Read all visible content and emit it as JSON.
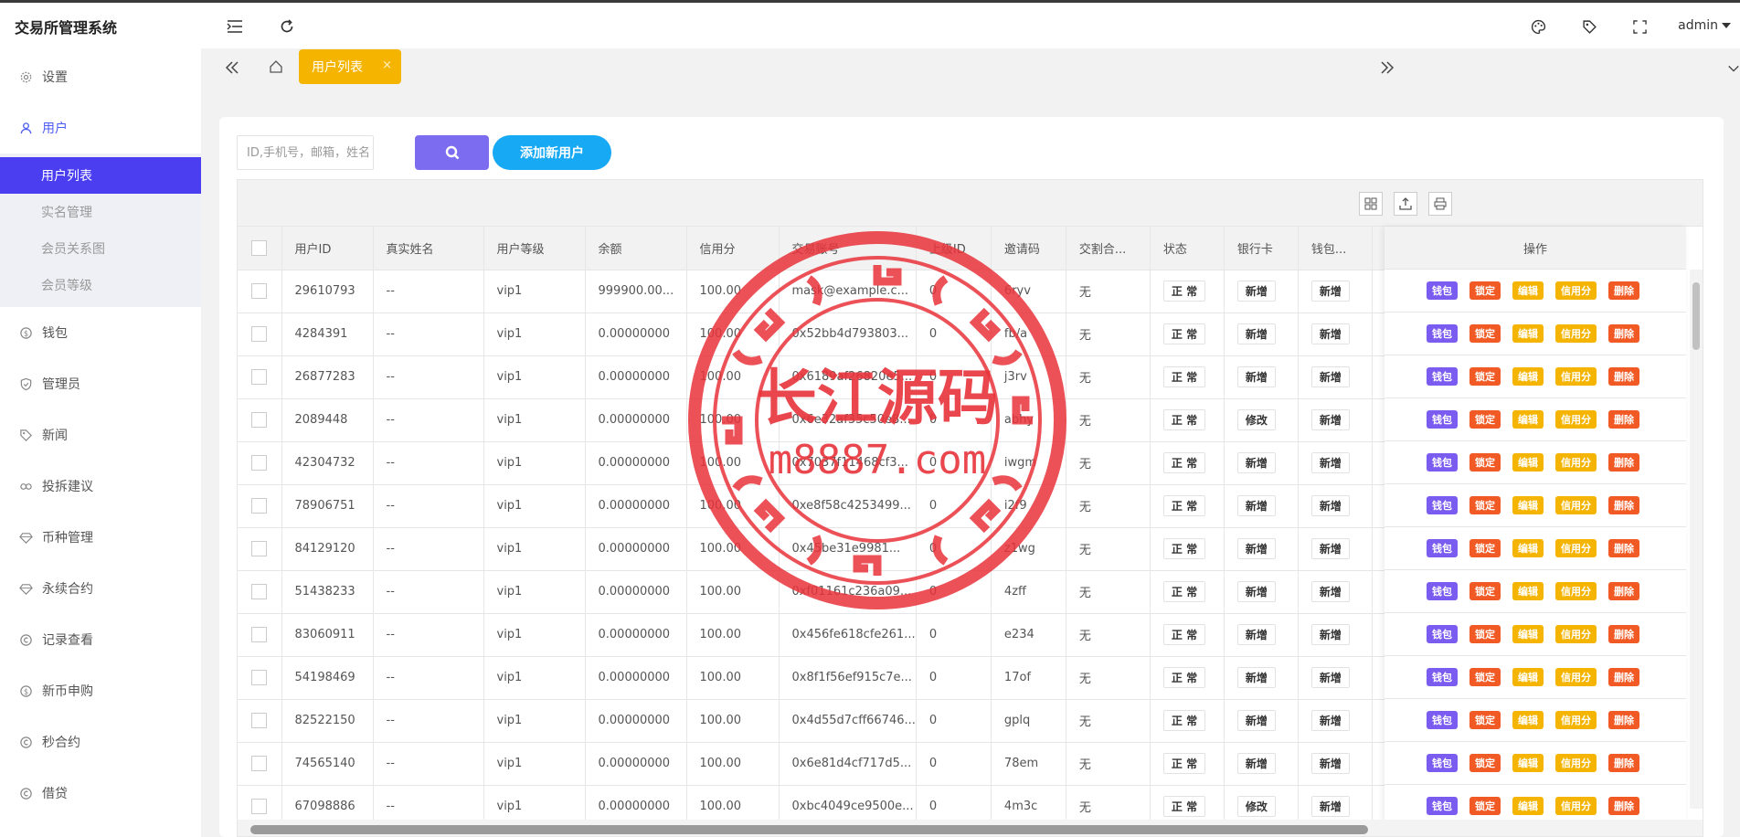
{
  "app": {
    "title": "交易所管理系统"
  },
  "header": {
    "user": "admin"
  },
  "sidebar": {
    "items": [
      {
        "label": "设置",
        "icon": "gear-icon"
      },
      {
        "label": "用户",
        "icon": "user-icon",
        "active": true
      },
      {
        "label": "钱包",
        "icon": "coin-icon"
      },
      {
        "label": "管理员",
        "icon": "shield-icon"
      },
      {
        "label": "新闻",
        "icon": "tag-icon"
      },
      {
        "label": "投拆建议",
        "icon": "link-icon"
      },
      {
        "label": "币种管理",
        "icon": "diamond-icon"
      },
      {
        "label": "永续合约",
        "icon": "diamond-icon"
      },
      {
        "label": "记录查看",
        "icon": "copyright-icon"
      },
      {
        "label": "新币申购",
        "icon": "coin-icon"
      },
      {
        "label": "秒合约",
        "icon": "copyright-icon"
      },
      {
        "label": "借贷",
        "icon": "copyright-icon"
      }
    ],
    "sub_items": [
      {
        "label": "用户列表",
        "active": true
      },
      {
        "label": "实名管理"
      },
      {
        "label": "会员关系图"
      },
      {
        "label": "会员等级"
      }
    ]
  },
  "tabs": {
    "active_label": "用户列表",
    "close": "×"
  },
  "search": {
    "placeholder": "ID,手机号，邮箱，姓名",
    "add_label": "添加新用户"
  },
  "table": {
    "headers": [
      "用户ID",
      "真实姓名",
      "用户等级",
      "余额",
      "信用分",
      "交易账号",
      "上级ID",
      "邀请码",
      "交割合...",
      "状态",
      "银行卡",
      "钱包..."
    ],
    "ops_header": "操作",
    "op_buttons": [
      {
        "label": "钱包",
        "color": "#7b5cf0"
      },
      {
        "label": "锁定",
        "color": "#f15a24"
      },
      {
        "label": "编辑",
        "color": "#f5b400"
      },
      {
        "label": "信用分",
        "color": "#f5b400"
      },
      {
        "label": "删除",
        "color": "#f15a24"
      }
    ],
    "rows": [
      [
        "29610793",
        "--",
        "vip1",
        "999900.00...",
        "100.00",
        "mask@example.c...",
        "0",
        "6ryv",
        "无",
        "正 常",
        "新增",
        "新增"
      ],
      [
        "4284391",
        "--",
        "vip1",
        "0.00000000",
        "100.00",
        "0x52bb4d793803...",
        "0",
        "fb/a",
        "无",
        "正 常",
        "新增",
        "新增"
      ],
      [
        "26877283",
        "--",
        "vip1",
        "0.00000000",
        "100.00",
        "0x6189af26820e5...",
        "0",
        "j3rv",
        "无",
        "正 常",
        "新增",
        "新增"
      ],
      [
        "2089448",
        "--",
        "vip1",
        "0.00000000",
        "100.00",
        "0x6e32af35c50e8...",
        "0",
        "abhy",
        "无",
        "正 常",
        "修改",
        "新增"
      ],
      [
        "42304732",
        "--",
        "vip1",
        "0.00000000",
        "100.00",
        "0x7037f11468cf3...",
        "0",
        "iwgm",
        "无",
        "正 常",
        "新增",
        "新增"
      ],
      [
        "78906751",
        "--",
        "vip1",
        "0.00000000",
        "100.00",
        "0xe8f58c4253499...",
        "0",
        "i2f9",
        "无",
        "正 常",
        "新增",
        "新增"
      ],
      [
        "84129120",
        "--",
        "vip1",
        "0.00000000",
        "100.00",
        "0x45be31e9981...",
        "0",
        "z1wg",
        "无",
        "正 常",
        "新增",
        "新增"
      ],
      [
        "51438233",
        "--",
        "vip1",
        "0.00000000",
        "100.00",
        "0xf01161c236a09...",
        "0",
        "4zff",
        "无",
        "正 常",
        "新增",
        "新增"
      ],
      [
        "83060911",
        "--",
        "vip1",
        "0.00000000",
        "100.00",
        "0x456fe618cfe261...",
        "0",
        "e234",
        "无",
        "正 常",
        "新增",
        "新增"
      ],
      [
        "54198469",
        "--",
        "vip1",
        "0.00000000",
        "100.00",
        "0x8f1f56ef915c7e...",
        "0",
        "17of",
        "无",
        "正 常",
        "新增",
        "新增"
      ],
      [
        "82522150",
        "--",
        "vip1",
        "0.00000000",
        "100.00",
        "0x4d55d7cff66746...",
        "0",
        "gplq",
        "无",
        "正 常",
        "新增",
        "新增"
      ],
      [
        "74565140",
        "--",
        "vip1",
        "0.00000000",
        "100.00",
        "0x6e81d4cf717d5...",
        "0",
        "78em",
        "无",
        "正 常",
        "新增",
        "新增"
      ],
      [
        "67098886",
        "--",
        "vip1",
        "0.00000000",
        "100.00",
        "0xbc4049ce9500e...",
        "0",
        "4m3c",
        "无",
        "正 常",
        "修改",
        "新增"
      ]
    ]
  },
  "watermark": {
    "title": "长江源码",
    "url": "m8887.com",
    "color": "#e8333a"
  }
}
